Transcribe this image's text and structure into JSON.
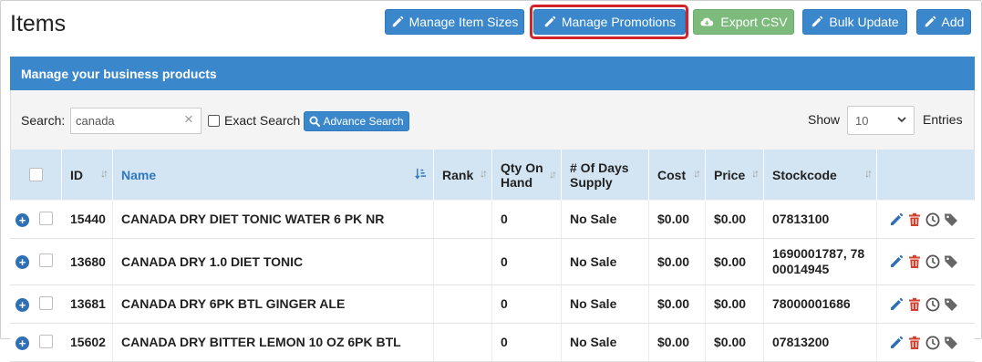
{
  "page": {
    "title": "Items"
  },
  "toolbar": {
    "manage_sizes": "Manage Item Sizes",
    "manage_promotions": "Manage Promotions",
    "export_csv": "Export CSV",
    "bulk_update": "Bulk Update",
    "add": "Add"
  },
  "panel": {
    "title": "Manage your business products"
  },
  "search": {
    "label": "Search:",
    "value": "canada",
    "exact_label": "Exact Search",
    "exact_checked": false,
    "advance_label": "Advance Search"
  },
  "show": {
    "label": "Show",
    "value": "10",
    "entries_label": "Entries"
  },
  "table": {
    "columns": [
      "ID",
      "Name",
      "Rank",
      "Qty On Hand",
      "# Of Days Supply",
      "Cost",
      "Price",
      "Stockcode"
    ],
    "sorted_column": "Name",
    "rows": [
      {
        "id": "15440",
        "name": "CANADA DRY DIET TONIC WATER 6 PK NR",
        "rank": "",
        "qty": "0",
        "days": "No Sale",
        "cost": "$0.00",
        "price": "$0.00",
        "stockcode": "07813100"
      },
      {
        "id": "13680",
        "name": "CANADA DRY 1.0 DIET TONIC",
        "rank": "",
        "qty": "0",
        "days": "No Sale",
        "cost": "$0.00",
        "price": "$0.00",
        "stockcode": "1690001787, 7800014945"
      },
      {
        "id": "13681",
        "name": "CANADA DRY 6PK BTL GINGER ALE",
        "rank": "",
        "qty": "0",
        "days": "No Sale",
        "cost": "$0.00",
        "price": "$0.00",
        "stockcode": "78000001686"
      },
      {
        "id": "15602",
        "name": "CANADA DRY BITTER LEMON 10 OZ 6PK BTL",
        "rank": "",
        "qty": "0",
        "days": "No Sale",
        "cost": "$0.00",
        "price": "$0.00",
        "stockcode": "07813200"
      }
    ]
  },
  "colors": {
    "accent": "#3a87cc",
    "export": "#7dbb7d",
    "highlight": "#d2232a",
    "header_bg": "#d3e5f2"
  }
}
